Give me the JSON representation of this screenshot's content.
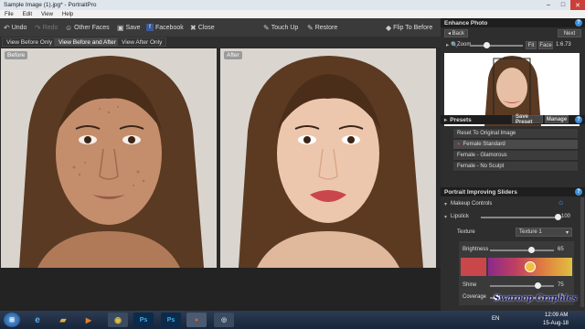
{
  "window": {
    "title": "Sample Image (1).jpg* - PortraitPro"
  },
  "menu": [
    "File",
    "Edit",
    "View",
    "Help"
  ],
  "toolbar": {
    "undo": "Undo",
    "redo": "Redo",
    "other_faces": "Other Faces",
    "save": "Save",
    "facebook": "Facebook",
    "close": "Close",
    "touch_up": "Touch Up",
    "restore": "Restore",
    "flip": "Flip To Before"
  },
  "view_tabs": [
    {
      "label": "View Before Only",
      "active": false
    },
    {
      "label": "View Before and After",
      "active": true
    },
    {
      "label": "View After Only",
      "active": false
    }
  ],
  "photos": {
    "before_label": "Before",
    "after_label": "After"
  },
  "enhance": {
    "title": "Enhance Photo",
    "back": "Back",
    "next": "Next",
    "zoom_label": "Zoom",
    "fit": "Fit",
    "face": "Face",
    "ratio": "1:6.73",
    "zoom_level": 0.32
  },
  "presets": {
    "title": "Presets",
    "save": "Save Preset",
    "manage": "Manage",
    "items": [
      "Reset To Original Image",
      "Female Standard",
      "Female - Glamorous",
      "Female - No Sculpt"
    ],
    "selected": 1
  },
  "sliders_panel": {
    "title": "Portrait Improving Sliders",
    "makeup_controls": "Makeup Controls",
    "lipstick": {
      "label": "Lipstick",
      "value": "100",
      "level": 1.0
    },
    "texture": {
      "label": "Texture",
      "value": "Texture 1"
    },
    "brightness": {
      "label": "Brightness",
      "value": "65",
      "level": 0.65
    },
    "shine": {
      "label": "Shine",
      "value": "75",
      "level": 0.75
    },
    "coverage": {
      "label": "Coverage",
      "value": "10",
      "level": 0.1
    }
  },
  "taskbar": {
    "time": "12:09 AM",
    "date": "15-Aug-18",
    "lang": "EN",
    "watermark": "Swaroop Graphics"
  },
  "colors": {
    "accent": "#3b8fd9",
    "panel_bg": "#2e2e2e",
    "header_bg": "#1e1e1e",
    "lips": "#c9474a"
  }
}
